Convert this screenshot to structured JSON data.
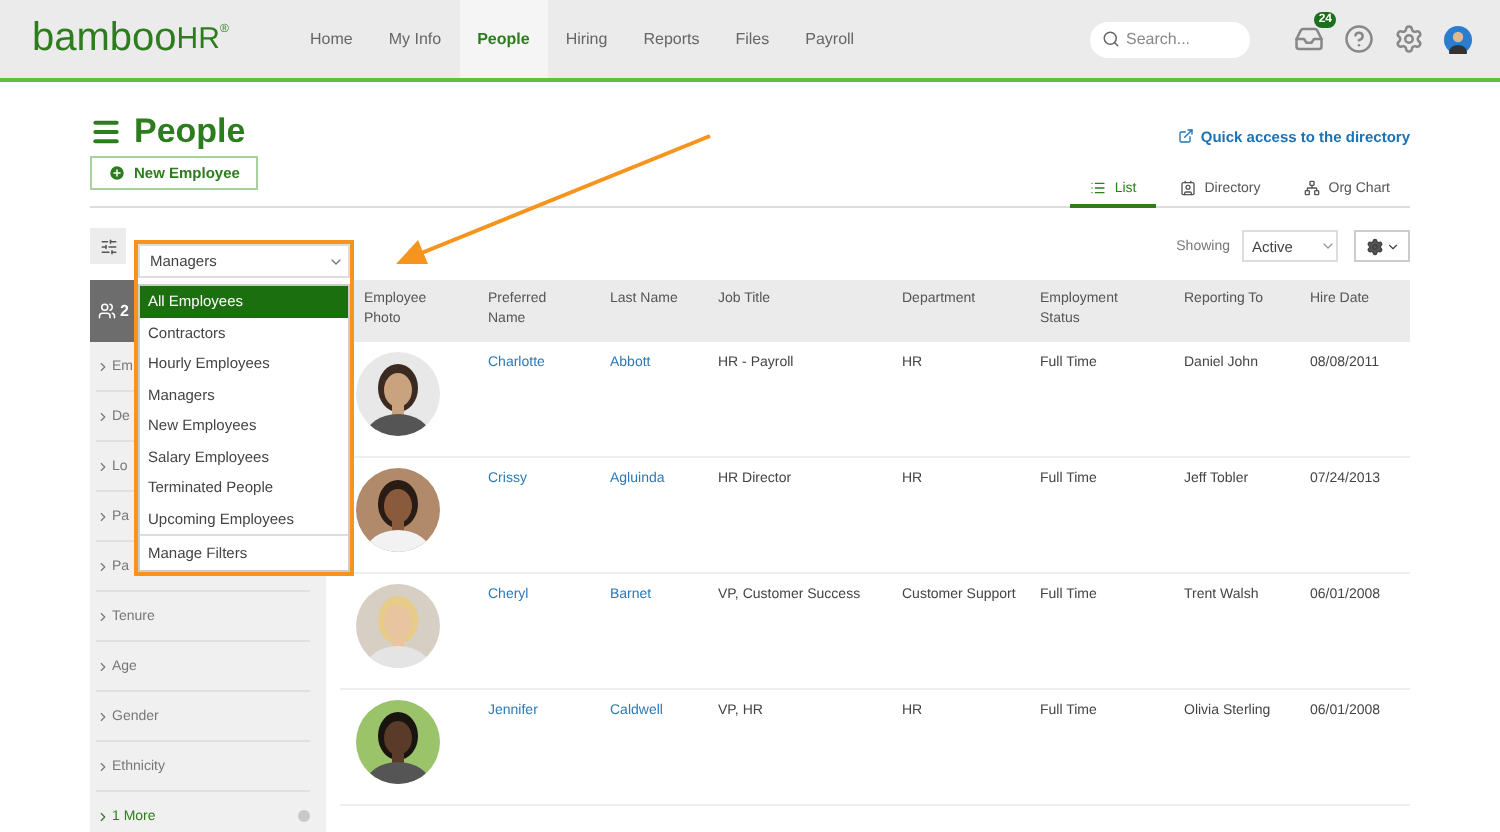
{
  "nav": {
    "logo": {
      "main": "bamboo",
      "suffix": "HR",
      "mark": "®"
    },
    "items": [
      {
        "label": "Home",
        "selected": false
      },
      {
        "label": "My Info",
        "selected": false
      },
      {
        "label": "People",
        "selected": true
      },
      {
        "label": "Hiring",
        "selected": false
      },
      {
        "label": "Reports",
        "selected": false
      },
      {
        "label": "Files",
        "selected": false
      },
      {
        "label": "Payroll",
        "selected": false
      }
    ],
    "search": {
      "placeholder": "Search..."
    },
    "inbox_badge": "24"
  },
  "page": {
    "title": "People",
    "new_employee_button": "New Employee",
    "quick_link": "Quick access to the directory",
    "view_tabs": [
      {
        "label": "List",
        "selected": true
      },
      {
        "label": "Directory",
        "selected": false
      },
      {
        "label": "Org Chart",
        "selected": false
      }
    ]
  },
  "filter": {
    "value": "Managers",
    "options": [
      {
        "label": "All Employees",
        "highlighted": true
      },
      {
        "label": "Contractors",
        "highlighted": false
      },
      {
        "label": "Hourly Employees",
        "highlighted": false
      },
      {
        "label": "Managers",
        "highlighted": false
      },
      {
        "label": "New Employees",
        "highlighted": false
      },
      {
        "label": "Salary Employees",
        "highlighted": false
      },
      {
        "label": "Terminated People",
        "highlighted": false
      },
      {
        "label": "Upcoming Employees",
        "highlighted": false
      }
    ],
    "manage": "Manage Filters"
  },
  "showing": {
    "label": "Showing",
    "value": "Active"
  },
  "sidebar": {
    "count": "2",
    "items": [
      "Em",
      "De",
      "Lo",
      "Pa",
      "Pa",
      "Tenure",
      "Age",
      "Gender",
      "Ethnicity"
    ],
    "more": "1 More"
  },
  "table": {
    "columns": [
      "Employee Photo",
      "Preferred Name",
      "Last Name",
      "Job Title",
      "Department",
      "Employment Status",
      "Reporting To",
      "Hire Date"
    ],
    "rows": [
      {
        "preferred_name": "Charlotte",
        "last_name": "Abbott",
        "job_title": "HR - Payroll",
        "department": "HR",
        "status": "Full Time",
        "reporting_to": "Daniel John",
        "hire_date": "08/08/2011"
      },
      {
        "preferred_name": "Crissy",
        "last_name": "Agluinda",
        "job_title": "HR Director",
        "department": "HR",
        "status": "Full Time",
        "reporting_to": "Jeff Tobler",
        "hire_date": "07/24/2013"
      },
      {
        "preferred_name": "Cheryl",
        "last_name": "Barnet",
        "job_title": "VP, Customer Success",
        "department": "Customer Support",
        "status": "Full Time",
        "reporting_to": "Trent Walsh",
        "hire_date": "06/01/2008"
      },
      {
        "preferred_name": "Jennifer",
        "last_name": "Caldwell",
        "job_title": "VP, HR",
        "department": "HR",
        "status": "Full Time",
        "reporting_to": "Olivia Sterling",
        "hire_date": "06/01/2008"
      }
    ]
  }
}
